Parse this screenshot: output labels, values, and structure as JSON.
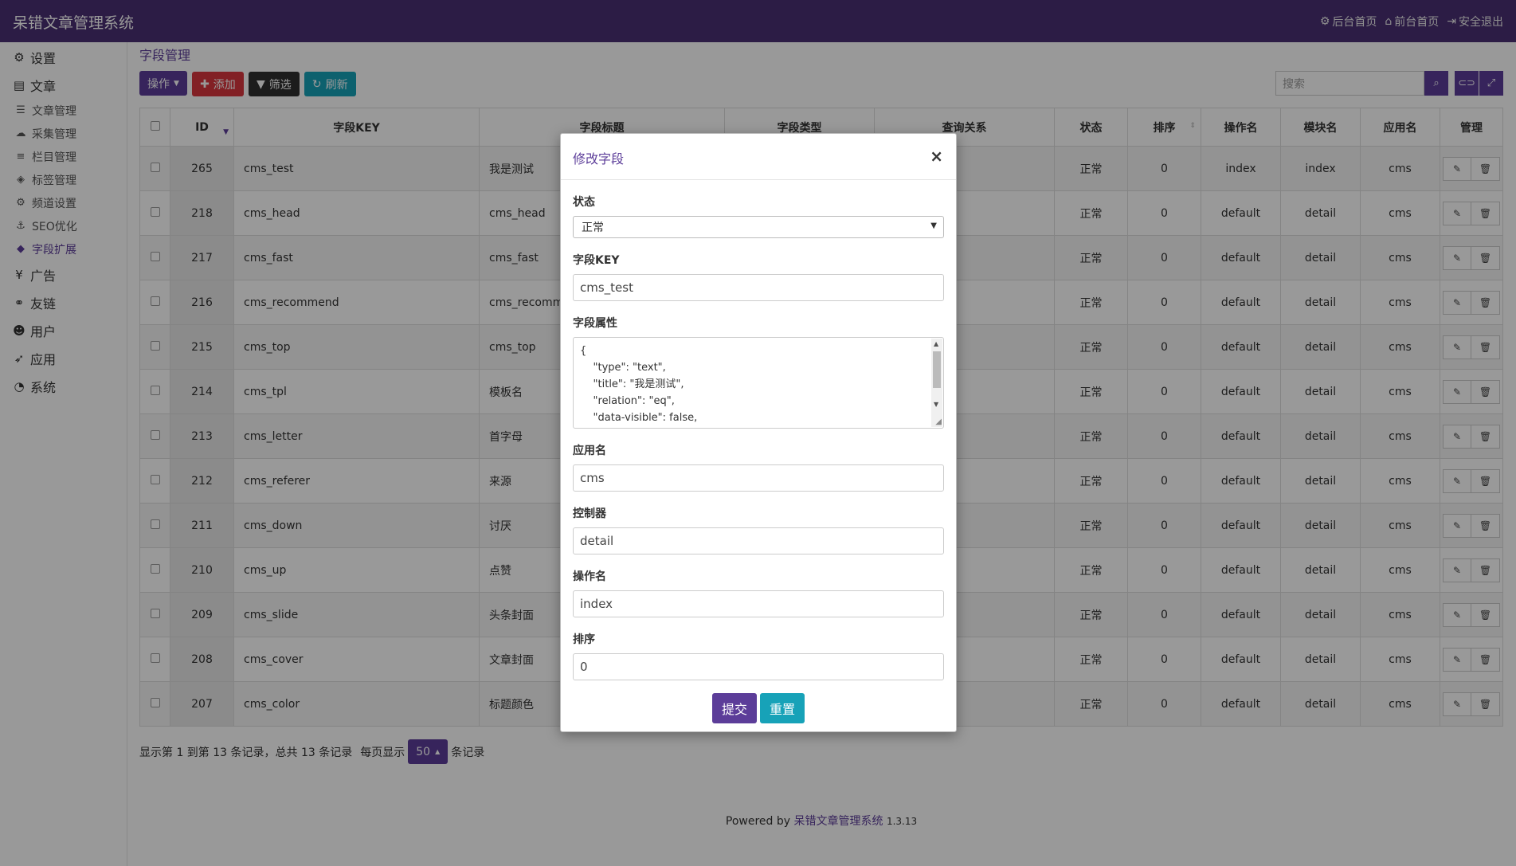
{
  "app": {
    "title": "呆错文章管理系统"
  },
  "topnav": [
    {
      "icon": "gear-icon",
      "glyph": "⚙",
      "label": "后台首页"
    },
    {
      "icon": "home-icon",
      "glyph": "⌂",
      "label": "前台首页"
    },
    {
      "icon": "logout-icon",
      "glyph": "⇥",
      "label": "安全退出"
    }
  ],
  "sidebar": {
    "settings": "设置",
    "article": "文章",
    "sub": {
      "article_manage": "文章管理",
      "collect": "采集管理",
      "column": "栏目管理",
      "tag": "标签管理",
      "channel": "频道设置",
      "seo": "SEO优化",
      "field": "字段扩展"
    },
    "ad": "广告",
    "links": "友链",
    "user": "用户",
    "apps": "应用",
    "system": "系统"
  },
  "breadcrumb": "字段管理",
  "toolbar": {
    "ops": "操作",
    "add": "添加",
    "filter": "筛选",
    "refresh": "刷新",
    "search_placeholder": "搜索"
  },
  "table": {
    "headers": {
      "id": "ID",
      "key": "字段KEY",
      "title": "字段标题",
      "type": "字段类型",
      "relation": "查询关系",
      "status": "状态",
      "sort": "排序",
      "action": "操作名",
      "module": "模块名",
      "app": "应用名",
      "manage": "管理"
    },
    "rows": [
      {
        "id": "265",
        "key": "cms_test",
        "title": "我是测试",
        "status": "正常",
        "sort": "0",
        "action": "index",
        "module": "index",
        "app": "cms"
      },
      {
        "id": "218",
        "key": "cms_head",
        "title": "cms_head",
        "status": "正常",
        "sort": "0",
        "action": "default",
        "module": "detail",
        "app": "cms"
      },
      {
        "id": "217",
        "key": "cms_fast",
        "title": "cms_fast",
        "status": "正常",
        "sort": "0",
        "action": "default",
        "module": "detail",
        "app": "cms"
      },
      {
        "id": "216",
        "key": "cms_recommend",
        "title": "cms_recomme",
        "status": "正常",
        "sort": "0",
        "action": "default",
        "module": "detail",
        "app": "cms"
      },
      {
        "id": "215",
        "key": "cms_top",
        "title": "cms_top",
        "status": "正常",
        "sort": "0",
        "action": "default",
        "module": "detail",
        "app": "cms"
      },
      {
        "id": "214",
        "key": "cms_tpl",
        "title": "模板名",
        "status": "正常",
        "sort": "0",
        "action": "default",
        "module": "detail",
        "app": "cms"
      },
      {
        "id": "213",
        "key": "cms_letter",
        "title": "首字母",
        "status": "正常",
        "sort": "0",
        "action": "default",
        "module": "detail",
        "app": "cms"
      },
      {
        "id": "212",
        "key": "cms_referer",
        "title": "来源",
        "status": "正常",
        "sort": "0",
        "action": "default",
        "module": "detail",
        "app": "cms"
      },
      {
        "id": "211",
        "key": "cms_down",
        "title": "讨厌",
        "status": "正常",
        "sort": "0",
        "action": "default",
        "module": "detail",
        "app": "cms"
      },
      {
        "id": "210",
        "key": "cms_up",
        "title": "点赞",
        "status": "正常",
        "sort": "0",
        "action": "default",
        "module": "detail",
        "app": "cms"
      },
      {
        "id": "209",
        "key": "cms_slide",
        "title": "头条封面",
        "status": "正常",
        "sort": "0",
        "action": "default",
        "module": "detail",
        "app": "cms"
      },
      {
        "id": "208",
        "key": "cms_cover",
        "title": "文章封面",
        "status": "正常",
        "sort": "0",
        "action": "default",
        "module": "detail",
        "app": "cms"
      },
      {
        "id": "207",
        "key": "cms_color",
        "title": "标题颜色",
        "status": "正常",
        "sort": "0",
        "action": "default",
        "module": "detail",
        "app": "cms"
      }
    ]
  },
  "pager": {
    "summary": "显示第 1 到第 13 条记录，总共 13 条记录",
    "per_page_prefix": "每页显示",
    "page_size": "50",
    "per_page_suffix": "条记录"
  },
  "footer": {
    "powered": "Powered by",
    "link": "呆错文章管理系统",
    "version": "1.3.13"
  },
  "modal": {
    "title": "修改字段",
    "status_label": "状态",
    "status_value": "正常",
    "key_label": "字段KEY",
    "key_value": "cms_test",
    "attr_label": "字段属性",
    "attr_lines": [
      "{",
      "    \"type\": \"text\",",
      "    \"title\": \"我是测试\",",
      "    \"relation\": \"eq\",",
      "    \"data-visible\": false,"
    ],
    "app_label": "应用名",
    "app_value": "cms",
    "controller_label": "控制器",
    "controller_value": "detail",
    "action_label": "操作名",
    "action_value": "index",
    "sort_label": "排序",
    "sort_value": "0",
    "submit": "提交",
    "reset": "重置"
  },
  "colors": {
    "primary": "#5c3d99",
    "topbar": "#4a2f73",
    "danger": "#d9363e",
    "dark": "#2f2f2f",
    "teal": "#17a2b8"
  }
}
